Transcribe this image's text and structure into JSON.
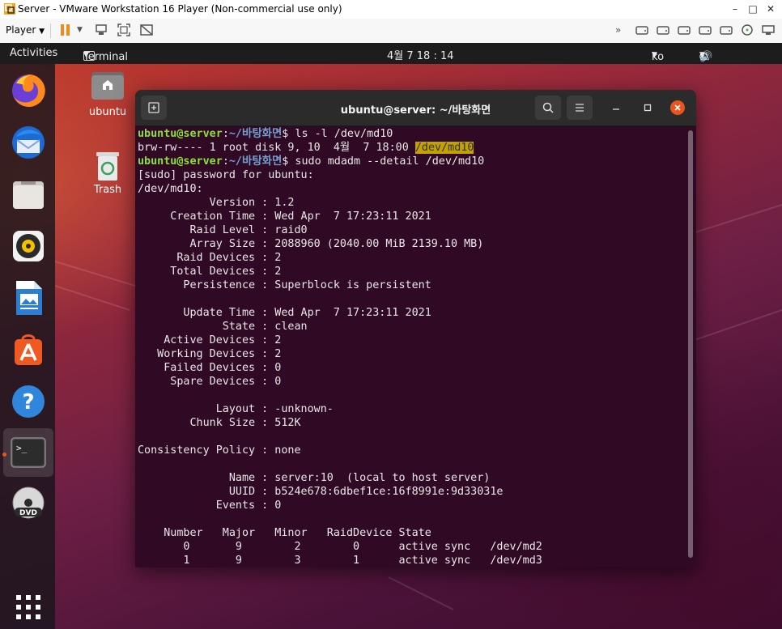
{
  "vm": {
    "title": "Server - VMware Workstation 16 Player (Non-commercial use only)",
    "player_label": "Player",
    "minimize": "–",
    "maximize": "□",
    "close": "✕"
  },
  "topbar": {
    "activities": "Activities",
    "app_menu": "Terminal",
    "clock": "4월 7  18 : 14",
    "lang": "ko"
  },
  "desktop": {
    "home_label": "ubuntu",
    "trash_label": "Trash"
  },
  "dock": {
    "items": [
      "firefox",
      "thunderbird",
      "files",
      "rhythmbox",
      "libreoffice-writer",
      "ubuntu-software",
      "help",
      "terminal",
      "dvd"
    ]
  },
  "terminal": {
    "title": "ubuntu@server: ~/바탕화면",
    "prompt_user": "ubuntu@server",
    "prompt_colon": ":",
    "prompt_path": "~/바탕화면",
    "prompt_dollar": "$",
    "cmd1": " ls -l /dev/md10",
    "ls_line": "brw-rw---- 1 root disk 9, 10  4월  7 18:00 ",
    "ls_file": "/dev/md10",
    "cmd2": " sudo mdadm --detail /dev/md10",
    "output": [
      "[sudo] password for ubuntu:",
      "/dev/md10:",
      "           Version : 1.2",
      "     Creation Time : Wed Apr  7 17:23:11 2021",
      "        Raid Level : raid0",
      "        Array Size : 2088960 (2040.00 MiB 2139.10 MB)",
      "      Raid Devices : 2",
      "     Total Devices : 2",
      "       Persistence : Superblock is persistent",
      "",
      "       Update Time : Wed Apr  7 17:23:11 2021",
      "             State : clean",
      "    Active Devices : 2",
      "   Working Devices : 2",
      "    Failed Devices : 0",
      "     Spare Devices : 0",
      "",
      "            Layout : -unknown-",
      "        Chunk Size : 512K",
      "",
      "Consistency Policy : none",
      "",
      "              Name : server:10  (local to host server)",
      "              UUID : b524e678:6dbef1ce:16f8991e:9d33031e",
      "            Events : 0",
      "",
      "    Number   Major   Minor   RaidDevice State",
      "       0       9        2        0      active sync   /dev/md2",
      "       1       9        3        1      active sync   /dev/md3"
    ]
  }
}
